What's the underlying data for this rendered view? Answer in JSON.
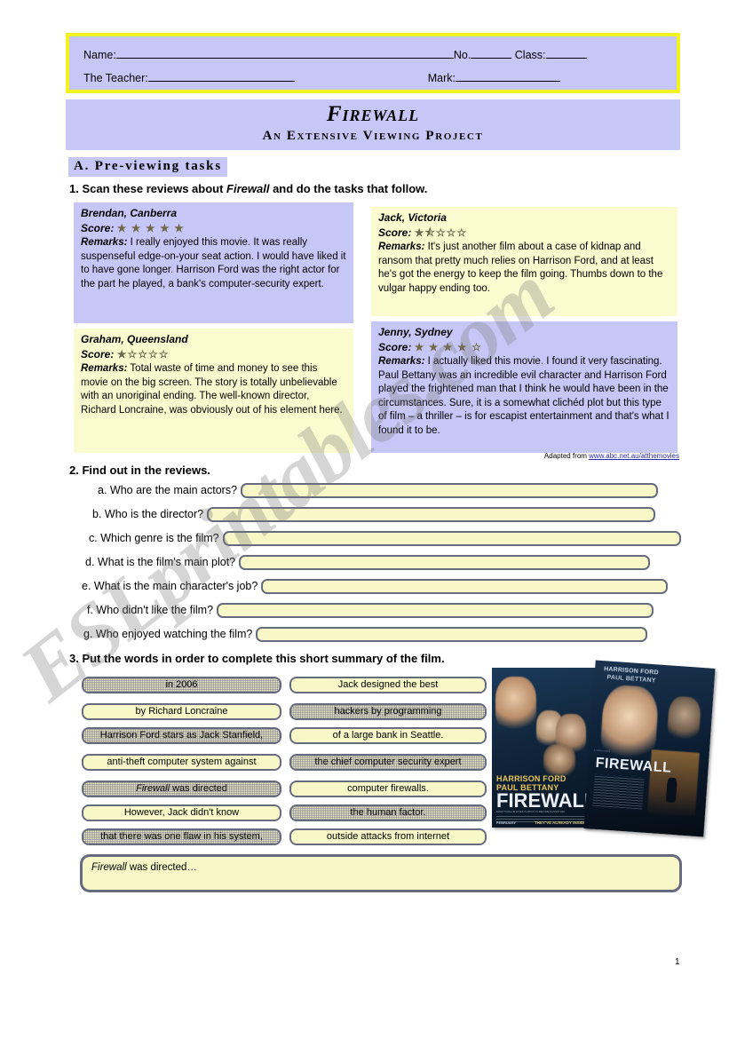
{
  "header": {
    "name_label": "Name:",
    "no_label": "No.",
    "class_label": "Class:",
    "teacher_label": "The Teacher:",
    "mark_label": "Mark:"
  },
  "title": {
    "main": "Firewall",
    "subtitle": "An Extensive Viewing Project"
  },
  "section_a": {
    "heading": "A. Pre-viewing tasks"
  },
  "task1": {
    "number": "1.",
    "text_before": "Scan these reviews about ",
    "film": "Firewall",
    "text_after": " and do the tasks that follow.",
    "score_label": "Score:",
    "remarks_label": "Remarks:",
    "reviews": [
      {
        "id": "brendan",
        "author": "Brendan, Canberra",
        "stars_full": 5,
        "stars_half": 0,
        "stars_empty": 0,
        "stars_glyphs": "★ ★ ★ ★ ★",
        "remarks": "I really enjoyed this movie. It was really suspenseful edge-on-your seat action. I would have liked it to have gone longer. Harrison Ford was the right actor for the part he played, a bank's computer-security expert.",
        "bg": "#c7c7f7"
      },
      {
        "id": "jack",
        "author": "Jack, Victoria",
        "stars_full": 1,
        "stars_half": 1,
        "stars_empty": 3,
        "stars_glyphs": "★⯪☆☆☆",
        "remarks": "It's just another film about a case of kidnap and ransom that pretty much relies on Harrison Ford, and at least he's got the energy to keep the film going. Thumbs down to the vulgar happy ending too.",
        "bg": "#fbfbd0"
      },
      {
        "id": "graham",
        "author": "Graham, Queensland",
        "stars_full": 1,
        "stars_half": 0,
        "stars_empty": 4,
        "stars_glyphs": "★☆☆☆☆",
        "remarks": "Total waste of time and money to see this movie on the big screen. The story is totally unbelievable with an unoriginal ending. The well-known director, Richard Loncraine, was obviously out of his element here.",
        "bg": "#fbfbd0"
      },
      {
        "id": "jenny",
        "author": "Jenny, Sydney",
        "stars_full": 4,
        "stars_half": 0,
        "stars_empty": 1,
        "stars_glyphs": "★ ★ ★ ★ ☆",
        "remarks": "I actually liked this movie. I found it very fascinating. Paul Bettany was an incredible evil character and Harrison Ford played the frightened man that I think he would have been in the circumstances. Sure, it is a somewhat clichéd plot but this type of film – a thriller – is for escapist entertainment and that's what I found it to be.",
        "bg": "#c7c7f7"
      }
    ],
    "attribution_prefix": "Adapted from ",
    "attribution_link": "www.abc.net.au/atthemovies"
  },
  "task2": {
    "number": "2.",
    "heading": "2. Find out in the reviews.",
    "questions": [
      {
        "label": "a. Who are the main actors?",
        "value": ""
      },
      {
        "label": "b. Who is the director?",
        "value": ""
      },
      {
        "label": "c. Which genre is the film?",
        "value": ""
      },
      {
        "label": "d. What is the film's main plot?",
        "value": ""
      },
      {
        "label": "e. What is the main character's job?",
        "value": ""
      },
      {
        "label": "f. Who didn't like the film?",
        "value": ""
      },
      {
        "label": "g. Who enjoyed watching the film?",
        "value": ""
      }
    ]
  },
  "task3": {
    "heading": "3. Put the words in order to complete this short summary of the film.",
    "chips_left": [
      {
        "text": "in 2006",
        "shaded": true,
        "italic_part": ""
      },
      {
        "text": "by Richard Loncraine",
        "shaded": false,
        "italic_part": ""
      },
      {
        "text": "Harrison Ford stars as Jack Stanfield,",
        "shaded": true,
        "italic_part": ""
      },
      {
        "text": "anti-theft computer system against",
        "shaded": false,
        "italic_part": ""
      },
      {
        "text": "Firewall was directed",
        "shaded": true,
        "italic_part": "Firewall"
      },
      {
        "text": "However, Jack didn't know",
        "shaded": false,
        "italic_part": ""
      },
      {
        "text": "that there was one flaw in his system,",
        "shaded": true,
        "italic_part": ""
      }
    ],
    "chips_right": [
      {
        "text": "Jack designed the best",
        "shaded": false,
        "italic_part": ""
      },
      {
        "text": "hackers by programming",
        "shaded": true,
        "italic_part": ""
      },
      {
        "text": "of a large bank in Seattle.",
        "shaded": false,
        "italic_part": ""
      },
      {
        "text": "the chief computer security expert",
        "shaded": true,
        "italic_part": ""
      },
      {
        "text": "computer firewalls.",
        "shaded": false,
        "italic_part": ""
      },
      {
        "text": "the human factor.",
        "shaded": true,
        "italic_part": ""
      },
      {
        "text": "outside attacks from internet",
        "shaded": false,
        "italic_part": ""
      }
    ]
  },
  "posters": {
    "poster_a": {
      "names": "HARRISON FORD",
      "names2": "PAUL BETTANY",
      "title": "FIREWALL",
      "tagline_small": "EVERYTHING HE LOVES IS ABOUT TO BECOME AGAINST HIM",
      "month": "FEBRUARY",
      "tagline": "THEY'VE ALREADY INSIDE."
    },
    "poster_b": {
      "names": "HARRISON FORD",
      "names2": "PAUL BETTANY",
      "title": "FIREWALL"
    }
  },
  "summary": {
    "prefix_italic": "Firewall",
    "rest": " was directed…"
  },
  "footer": {
    "page_number": "1"
  },
  "watermark": {
    "text": "ESLprintables.com"
  },
  "colors": {
    "lavender": "#c7c7f7",
    "pale_yellow": "#fbfbd0",
    "field_yellow": "#f7f7c8",
    "border_gray": "#676b80",
    "header_border_yellow": "#f2f21e",
    "link_blue": "#2a2ab0"
  }
}
